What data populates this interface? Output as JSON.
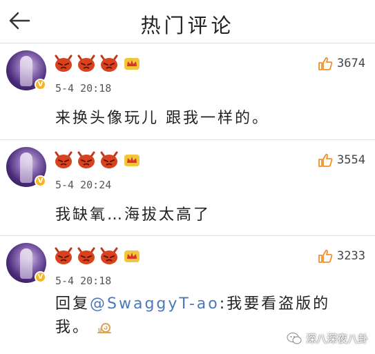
{
  "header": {
    "title": "热门评论",
    "back_icon": "back-arrow-icon"
  },
  "comments": [
    {
      "time": "5-4 20:18",
      "likes": "3674",
      "text": "来换头像玩儿 跟我一样的。",
      "badge_icons": [
        "devil-icon",
        "devil-icon",
        "devil-icon",
        "crown-icon"
      ]
    },
    {
      "time": "5-4 20:24",
      "likes": "3554",
      "text": "我缺氧…海拔太高了",
      "badge_icons": [
        "devil-icon",
        "devil-icon",
        "devil-icon",
        "crown-icon"
      ]
    },
    {
      "time": "5-4 20:18",
      "likes": "3233",
      "reply_prefix": "回复",
      "mention": "@SwaggyT-ao",
      "text_line1": ":我要看盗版的",
      "text_line2": "我。",
      "badge_icons": [
        "devil-icon",
        "devil-icon",
        "devil-icon",
        "crown-icon"
      ]
    }
  ],
  "watermark": {
    "text": "深八深夜八卦"
  },
  "colors": {
    "mention": "#4a78b8",
    "verified_badge": "#f6b624",
    "like_icon": "#f0902a",
    "devil": "#d8431e"
  }
}
